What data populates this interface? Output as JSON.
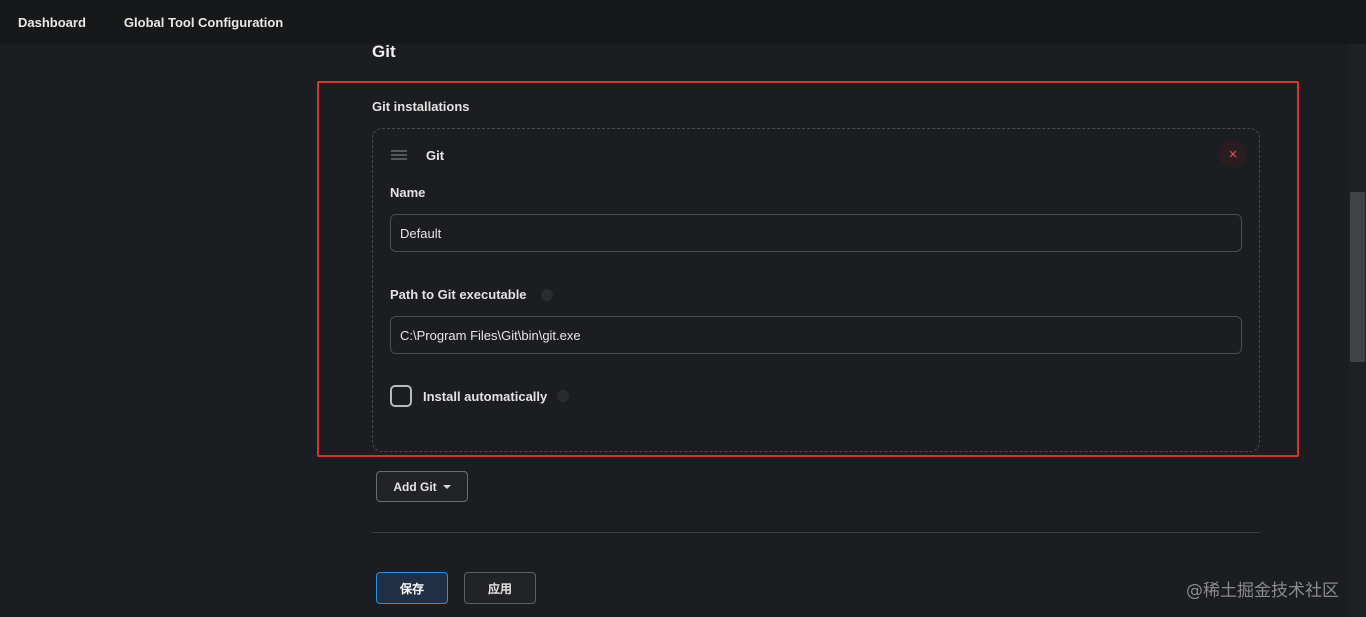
{
  "breadcrumb": {
    "items": [
      "Dashboard",
      "Global Tool Configuration"
    ]
  },
  "section": {
    "title": "Git"
  },
  "installations": {
    "label": "Git installations",
    "tool": {
      "title": "Git",
      "delete_icon": "×",
      "name_label": "Name",
      "name_value": "Default",
      "path_label": "Path to Git executable",
      "path_value": "C:\\Program Files\\Git\\bin\\git.exe",
      "install_auto_label": "Install automatically",
      "install_auto_checked": false
    },
    "add_button_label": "Add Git"
  },
  "footer": {
    "save_label": "保存",
    "apply_label": "应用"
  },
  "watermark": "@稀土掘金技术社区",
  "colors": {
    "highlight_border": "#e0302a",
    "primary_button_border": "#2f8fd8",
    "delete_icon": "#e05260"
  },
  "icons": {
    "drag": "drag-handle-icon",
    "delete": "close-icon",
    "dropdown": "chevron-down-icon",
    "help": "help-icon"
  }
}
